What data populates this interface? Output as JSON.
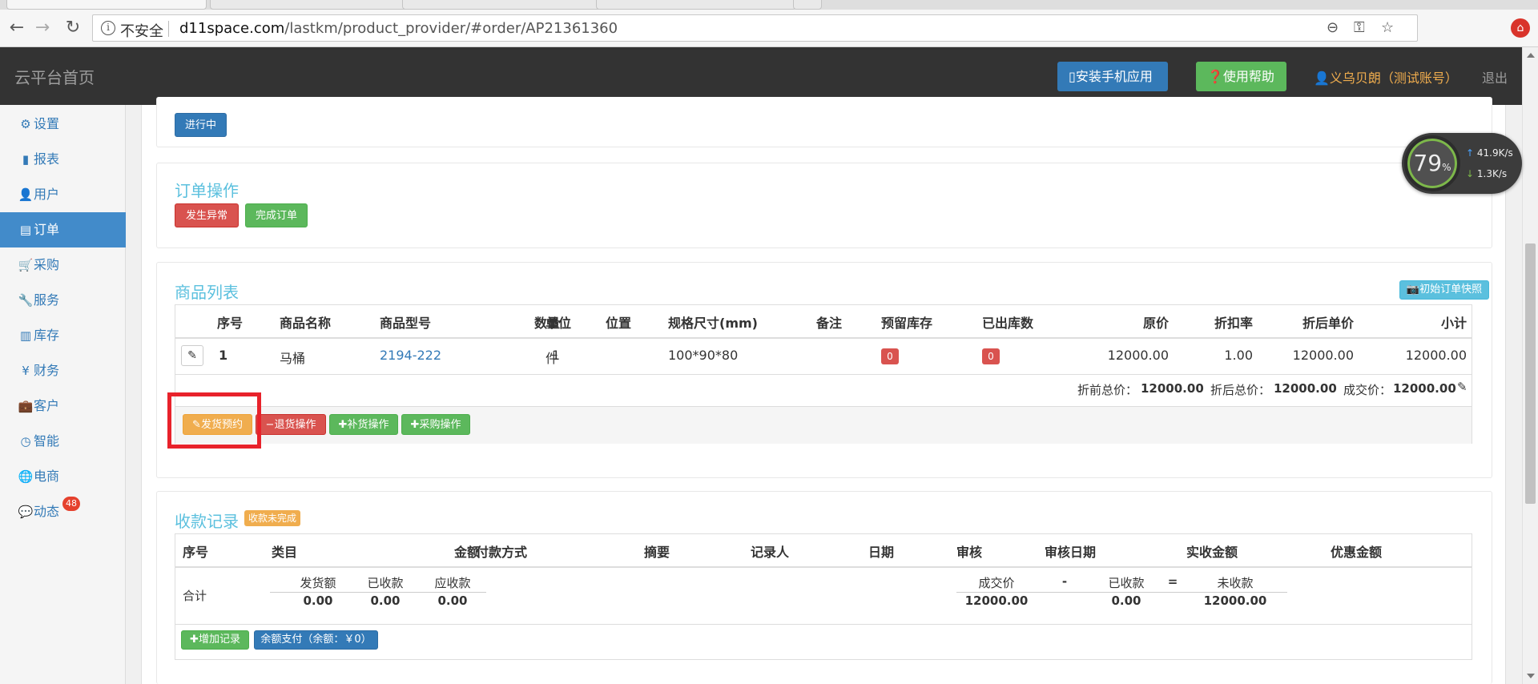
{
  "browser": {
    "address": {
      "insecure_label": "不安全",
      "host": "d11space.com",
      "path": "/lastkm/product_provider/#order/AP21361360"
    }
  },
  "header": {
    "brand": "云平台首页",
    "install_app_label": "安装手机应用",
    "help_label": "使用帮助",
    "user_label": "义乌贝朗（测试账号）",
    "logout_label": "退出"
  },
  "sidebar": {
    "items": [
      {
        "label": "设置",
        "icon": "gear-icon"
      },
      {
        "label": "报表",
        "icon": "bar-chart-icon"
      },
      {
        "label": "用户",
        "icon": "user-icon"
      },
      {
        "label": "订单",
        "icon": "list-alt-icon",
        "active": true
      },
      {
        "label": "采购",
        "icon": "shopping-cart-icon"
      },
      {
        "label": "服务",
        "icon": "wrench-icon"
      },
      {
        "label": "库存",
        "icon": "barcode-icon"
      },
      {
        "label": "财务",
        "icon": "yen-icon"
      },
      {
        "label": "客户",
        "icon": "briefcase-icon"
      },
      {
        "label": "智能",
        "icon": "dashboard-icon"
      },
      {
        "label": "电商",
        "icon": "globe-icon"
      },
      {
        "label": "动态",
        "icon": "comment-icon",
        "badge": "48"
      }
    ]
  },
  "status": {
    "in_progress_label": "进行中"
  },
  "order_ops": {
    "title": "订单操作",
    "exception_label": "发生异常",
    "complete_label": "完成订单"
  },
  "products": {
    "title": "商品列表",
    "snapshot_label": "初始订单快照",
    "columns": {
      "seq": "序号",
      "name": "商品名称",
      "model": "商品型号",
      "qty": "数量",
      "unit": "单位",
      "location": "位置",
      "spec": "规格尺寸(mm)",
      "note": "备注",
      "reserved": "预留库存",
      "shipped": "已出库数",
      "price": "原价",
      "discount": "折扣率",
      "disc_price": "折后单价",
      "subtotal": "小计"
    },
    "rows": [
      {
        "seq": "1",
        "name": "马桶",
        "model": "2194-222",
        "qty": "1",
        "unit": "件",
        "spec": "100*90*80",
        "reserved": "0",
        "shipped": "0",
        "price": "12000.00",
        "discount": "1.00",
        "disc_price": "12000.00",
        "subtotal": "12000.00"
      }
    ],
    "totals": {
      "before_label": "折前总价：",
      "before_value": "12000.00",
      "after_label": "折后总价：",
      "after_value": "12000.00",
      "deal_label": "成交价：",
      "deal_value": "12000.00"
    },
    "actions": {
      "ship_label": "发货预约",
      "return_label": "退货操作",
      "restock_label": "补货操作",
      "purchase_label": "采购操作"
    }
  },
  "payments": {
    "title": "收款记录",
    "status_label": "收款未完成",
    "columns": {
      "seq": "序号",
      "category": "类目",
      "amount": "金额",
      "method": "付款方式",
      "summary": "摘要",
      "recorder": "记录人",
      "date": "日期",
      "audit": "审核",
      "audit_date": "审核日期",
      "received": "实收金额",
      "discount": "优惠金额"
    },
    "summary": {
      "total_label": "合计",
      "shipped_amount_label": "发货额",
      "shipped_amount": "0.00",
      "received_label": "已收款",
      "received": "0.00",
      "receivable_label": "应收款",
      "receivable": "0.00",
      "deal_label": "成交价",
      "deal": "12000.00",
      "minus": "-",
      "received2_label": "已收款",
      "received2": "0.00",
      "equals": "=",
      "unpaid_label": "未收款",
      "unpaid": "12000.00"
    },
    "add_label": "增加记录",
    "balance_label": "余额支付（余额：￥0）"
  },
  "netspeed": {
    "percent": "79",
    "up": "41.9",
    "down": "1.3",
    "unit": "K/s"
  }
}
